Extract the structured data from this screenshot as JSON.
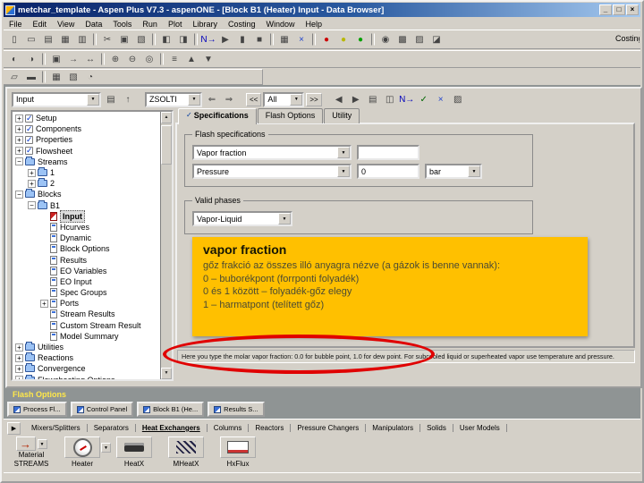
{
  "window": {
    "title": "metchar_template - Aspen Plus V7.3 - aspenONE - [Block B1 (Heater) Input - Data Browser]",
    "controls": {
      "minimize": "_",
      "maximize": "□",
      "close": "×"
    }
  },
  "menu": {
    "items": [
      "File",
      "Edit",
      "View",
      "Data",
      "Tools",
      "Run",
      "Plot",
      "Library",
      "Costing",
      "Window",
      "Help"
    ]
  },
  "toolbar_main": {
    "right_label": "Costing",
    "icons": [
      {
        "name": "new-icon",
        "g": "▯"
      },
      {
        "name": "open-icon",
        "g": "▭"
      },
      {
        "name": "save-icon",
        "g": "▤"
      },
      {
        "name": "print-icon",
        "g": "▦"
      },
      {
        "name": "print-preview-icon",
        "g": "▥"
      },
      {
        "sep": true
      },
      {
        "name": "cut-icon",
        "g": "✂"
      },
      {
        "name": "copy-icon",
        "g": "▣"
      },
      {
        "name": "paste-icon",
        "g": "▧"
      },
      {
        "sep": true
      },
      {
        "name": "flowsheet-icon",
        "g": "◧"
      },
      {
        "name": "section-icon",
        "g": "◨"
      },
      {
        "sep": true
      },
      {
        "name": "next-icon",
        "g": "N→",
        "c": "#0000bb"
      },
      {
        "name": "run-icon",
        "g": "▶"
      },
      {
        "name": "step-icon",
        "g": "▮"
      },
      {
        "name": "stop-icon",
        "g": "■"
      },
      {
        "sep": true
      },
      {
        "name": "settings-table-icon",
        "g": "▦"
      },
      {
        "name": "cancel-icon",
        "g": "×",
        "c": "#2244cc"
      },
      {
        "sep": true
      },
      {
        "name": "status-red-icon",
        "g": "●",
        "c": "#cc0000"
      },
      {
        "name": "status-yellow-icon",
        "g": "●",
        "c": "#b8b800"
      },
      {
        "name": "status-green-icon",
        "g": "●",
        "c": "#00a000"
      },
      {
        "sep": true
      },
      {
        "name": "history-icon",
        "g": "◉"
      },
      {
        "name": "data-browser-icon",
        "g": "▩"
      },
      {
        "name": "control-panel-icon",
        "g": "▨"
      },
      {
        "name": "costing-icon",
        "g": "◪"
      }
    ]
  },
  "toolbar_second": {
    "icons": [
      {
        "name": "variable-explorer-icon",
        "g": "◐"
      },
      {
        "name": "eo-sync-icon",
        "g": "◑"
      },
      {
        "sep": true
      },
      {
        "name": "insert-block-icon",
        "g": "▣"
      },
      {
        "name": "insert-stream-icon",
        "g": "→"
      },
      {
        "name": "reroute-stream-icon",
        "g": "↔"
      },
      {
        "sep": true
      },
      {
        "name": "zoom-in-icon",
        "g": "⊕"
      },
      {
        "name": "zoom-out-icon",
        "g": "⊖"
      },
      {
        "name": "zoom-full-icon",
        "g": "◎"
      },
      {
        "sep": true
      },
      {
        "name": "align-icon",
        "g": "≡"
      },
      {
        "name": "view-parent-icon",
        "g": "▲"
      },
      {
        "name": "view-child-icon",
        "g": "▼"
      }
    ]
  },
  "toolbar_third": {
    "icons": [
      {
        "name": "annotation-icon",
        "g": "▱"
      },
      {
        "name": "text-tool-icon",
        "g": "▬"
      },
      {
        "sep": true
      },
      {
        "name": "grid-toggle-icon",
        "g": "▦"
      },
      {
        "name": "section-display-icon",
        "g": "▧"
      },
      {
        "name": "refresh-icon",
        "g": "◔"
      }
    ]
  },
  "browser_toolbar": {
    "nav_combo": "Input",
    "units_combo": "ZSOLTI",
    "filter_combo": "All",
    "prev_sheets": "<<",
    "next_sheets": ">>",
    "icons_a": [
      {
        "name": "sheet-icon",
        "g": "▤"
      },
      {
        "name": "parent-level-icon",
        "g": "↑"
      }
    ],
    "icons_b": [
      {
        "name": "prev-units-icon",
        "g": "⇐"
      },
      {
        "name": "next-units-icon",
        "g": "⇒"
      }
    ],
    "icons_c": [
      {
        "name": "prev-form-icon",
        "g": "◀"
      },
      {
        "name": "next-form-icon",
        "g": "▶"
      },
      {
        "name": "comments-icon",
        "g": "▤"
      },
      {
        "name": "compare-icon",
        "g": "◫"
      },
      {
        "name": "next-input-icon",
        "g": "N→",
        "c": "#0000bb"
      },
      {
        "name": "check-status-icon",
        "g": "✓",
        "c": "#006600"
      },
      {
        "name": "delete-icon",
        "g": "×",
        "c": "#2244cc"
      },
      {
        "name": "hide-icon",
        "g": "▨"
      }
    ]
  },
  "tree": {
    "items": [
      {
        "label": "Setup",
        "level": 0,
        "icon": "check",
        "expand": "+"
      },
      {
        "label": "Components",
        "level": 0,
        "icon": "check",
        "expand": "+"
      },
      {
        "label": "Properties",
        "level": 0,
        "icon": "check",
        "expand": "+"
      },
      {
        "label": "Flowsheet",
        "level": 0,
        "icon": "check",
        "expand": "+"
      },
      {
        "label": "Streams",
        "level": 0,
        "icon": "folder",
        "expand": "−"
      },
      {
        "label": "1",
        "level": 1,
        "icon": "folder",
        "expand": "+"
      },
      {
        "label": "2",
        "level": 1,
        "icon": "folder",
        "expand": "+"
      },
      {
        "label": "Blocks",
        "level": 0,
        "icon": "folder",
        "expand": "−"
      },
      {
        "label": "B1",
        "level": 1,
        "icon": "folder",
        "expand": "−"
      },
      {
        "label": "Input",
        "level": 2,
        "icon": "formred",
        "expand": "",
        "selected": true
      },
      {
        "label": "Hcurves",
        "level": 2,
        "icon": "form",
        "expand": ""
      },
      {
        "label": "Dynamic",
        "level": 2,
        "icon": "form",
        "expand": ""
      },
      {
        "label": "Block Options",
        "level": 2,
        "icon": "form",
        "expand": ""
      },
      {
        "label": "Results",
        "level": 2,
        "icon": "form",
        "expand": ""
      },
      {
        "label": "EO Variables",
        "level": 2,
        "icon": "form",
        "expand": ""
      },
      {
        "label": "EO Input",
        "level": 2,
        "icon": "form",
        "expand": ""
      },
      {
        "label": "Spec Groups",
        "level": 2,
        "icon": "form",
        "expand": ""
      },
      {
        "label": "Ports",
        "level": 2,
        "icon": "form",
        "expand": "+"
      },
      {
        "label": "Stream Results",
        "level": 2,
        "icon": "form",
        "expand": ""
      },
      {
        "label": "Custom Stream Result",
        "level": 2,
        "icon": "form",
        "expand": ""
      },
      {
        "label": "Model Summary",
        "level": 2,
        "icon": "form",
        "expand": ""
      },
      {
        "label": "Utilities",
        "level": 0,
        "icon": "folder",
        "expand": "+"
      },
      {
        "label": "Reactions",
        "level": 0,
        "icon": "folder",
        "expand": "+"
      },
      {
        "label": "Convergence",
        "level": 0,
        "icon": "folder",
        "expand": "+"
      },
      {
        "label": "Flowsheeting Options",
        "level": 0,
        "icon": "folder",
        "expand": "+"
      }
    ]
  },
  "panel": {
    "tabs": [
      {
        "name": "tab-specifications",
        "label": "Specifications",
        "check": true,
        "active": true
      },
      {
        "name": "tab-flash-options",
        "label": "Flash Options"
      },
      {
        "name": "tab-utility",
        "label": "Utility"
      }
    ],
    "flash_group": {
      "legend": "Flash specifications",
      "rows": [
        {
          "combo": "Vapor fraction",
          "value": ""
        },
        {
          "combo": "Pressure",
          "value": "0",
          "unit": "bar"
        }
      ]
    },
    "phases_group": {
      "legend": "Valid phases",
      "combo": "Vapor-Liquid"
    }
  },
  "annotation": {
    "title": "vapor fraction",
    "lines": [
      "gőz frakció az összes illó anyagra nézve (a gázok is benne vannak):",
      "0 – buborékpont (forrponti folyadék)",
      "0 és 1 között – folyadék-gőz elegy",
      "1 – harmatpont (telített gőz)"
    ]
  },
  "prompt": {
    "text": "Here you type the molar vapor fraction: 0.0 for bubble point, 1.0 for dew point. For subcooled liquid or superheated vapor use temperature and pressure."
  },
  "caption": {
    "text": "Flash Options"
  },
  "taskbar": {
    "buttons": [
      {
        "name": "taskbar-process-flowsheet",
        "label": "Process Fl..."
      },
      {
        "name": "taskbar-control-panel",
        "label": "Control Panel"
      },
      {
        "name": "taskbar-block-b1",
        "label": "Block B1 (He..."
      },
      {
        "name": "taskbar-results-summary",
        "label": "Results S..."
      }
    ]
  },
  "palette": {
    "tabs": [
      {
        "name": "palette-tab-mixers",
        "label": "Mixers/Splitters"
      },
      {
        "name": "palette-tab-separators",
        "label": "Separators"
      },
      {
        "name": "palette-tab-heat-exchangers",
        "label": "Heat Exchangers",
        "active": true
      },
      {
        "name": "palette-tab-columns",
        "label": "Columns"
      },
      {
        "name": "palette-tab-reactors",
        "label": "Reactors"
      },
      {
        "name": "palette-tab-pressure-changers",
        "label": "Pressure Changers"
      },
      {
        "name": "palette-tab-manipulators",
        "label": "Manipulators"
      },
      {
        "name": "palette-tab-solids",
        "label": "Solids"
      },
      {
        "name": "palette-tab-user-models",
        "label": "User Models"
      }
    ],
    "streams": {
      "material": "Material",
      "streams": "STREAMS"
    },
    "models": [
      {
        "name": "model-heater",
        "label": "Heater",
        "icon": "heater",
        "dropdown": true
      },
      {
        "name": "model-heatx",
        "label": "HeatX",
        "icon": "heatx"
      },
      {
        "name": "model-mheatx",
        "label": "MHeatX",
        "icon": "mheatx"
      },
      {
        "name": "model-hxflux",
        "label": "HxFlux",
        "icon": "hxflux"
      }
    ]
  },
  "colors": {
    "annotation_bg": "#FFC000",
    "ellipse_red": "#E00000",
    "titlebar_left": "#0A246A",
    "titlebar_right": "#A6CAF0",
    "chrome_gray": "#D4D0C8"
  }
}
